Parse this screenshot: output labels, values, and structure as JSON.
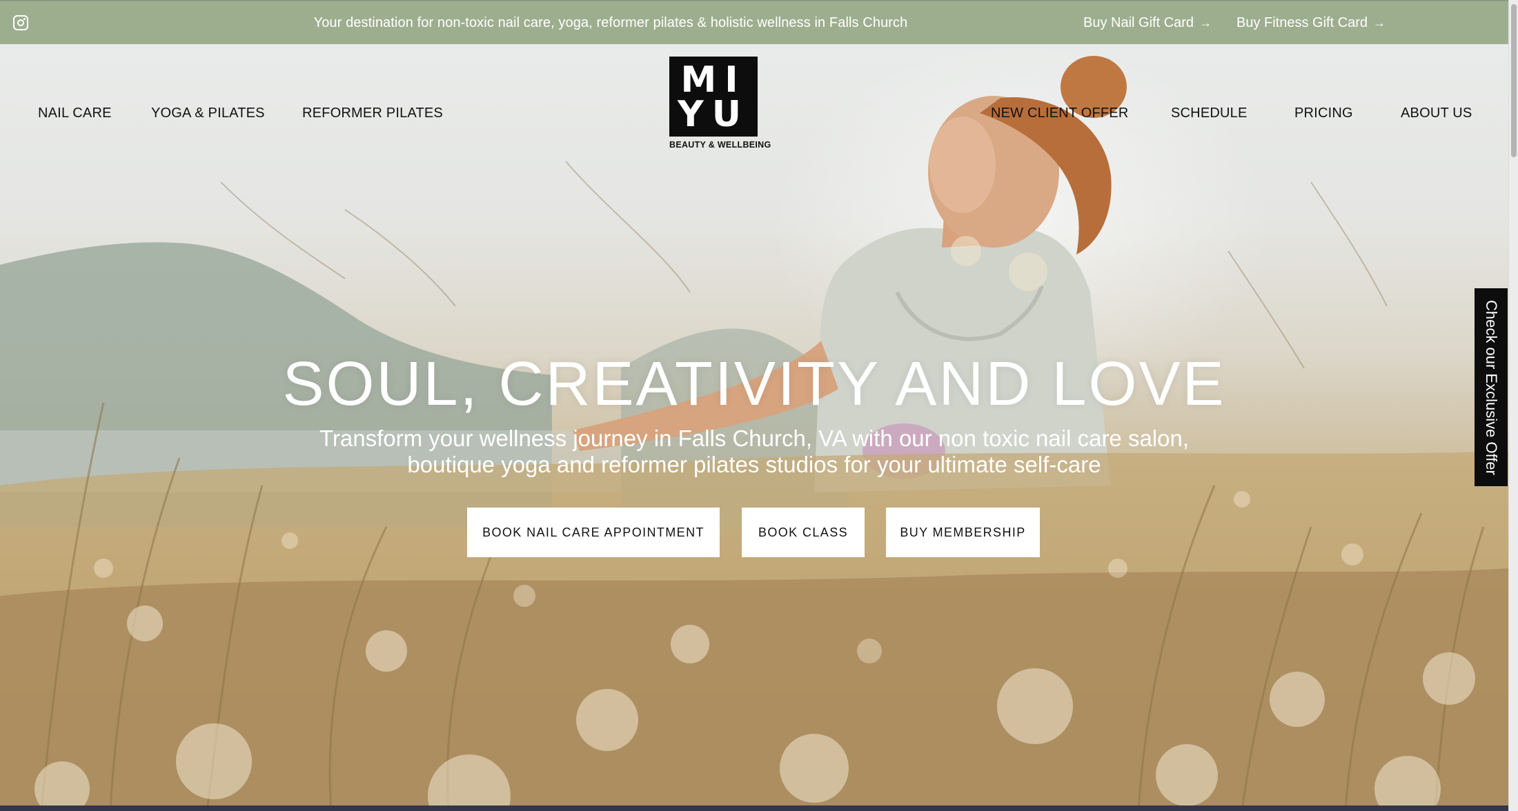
{
  "topbar": {
    "instagram_icon": "instagram-icon",
    "announcement": "Your destination for non-toxic nail care, yoga, reformer pilates & holistic wellness in Falls Church",
    "gift_nail": "Buy Nail Gift Card",
    "gift_fitness": "Buy Fitness Gift Card",
    "arrow": "→",
    "bg_color": "#9dae8f"
  },
  "nav": {
    "left": [
      "NAIL CARE",
      "YOGA & PILATES",
      "REFORMER PILATES"
    ],
    "right": [
      "NEW CLIENT OFFER",
      "SCHEDULE",
      "PRICING",
      "ABOUT US"
    ]
  },
  "logo": {
    "line1": "MI",
    "line2": "YU",
    "tagline": "BEAUTY & WELLBEING"
  },
  "hero": {
    "headline": "SOUL, CREATIVITY AND LOVE",
    "subline": "Transform your wellness journey in Falls Church, VA with our non toxic nail care salon, boutique yoga and reformer pilates studios for your ultimate self-care",
    "buttons": [
      "BOOK NAIL CARE APPOINTMENT",
      "BOOK CLASS",
      "BUY MEMBERSHIP"
    ]
  },
  "side_tab": {
    "label": "Check our Exclusive Offer"
  }
}
